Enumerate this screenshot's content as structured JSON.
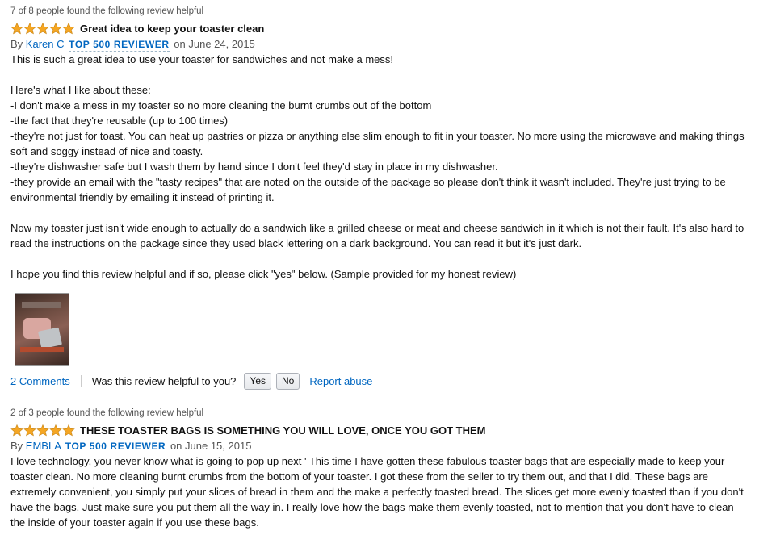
{
  "reviews": [
    {
      "helpful_count": "7 of 8 people found the following review helpful",
      "rating": 5,
      "title": "Great idea to keep your toaster clean",
      "by_prefix": "By",
      "author": "Karen C",
      "badge": "TOP 500 REVIEWER",
      "date": "on June 24, 2015",
      "paragraphs": [
        [
          "This is such a great idea to use your toaster for sandwiches and not make a mess!"
        ],
        [
          "Here's what I like about these:",
          "-I don't make a mess in my toaster so no more cleaning the burnt crumbs out of the bottom",
          "-the fact that they're reusable (up to 100 times)",
          "-they're not just for toast. You can heat up pastries or pizza or anything else slim enough to fit in your toaster. No more using the microwave and making things",
          "soft and soggy instead of nice and toasty.",
          "-they're dishwasher safe but I wash them by hand since I don't feel they'd stay in place in my dishwasher.",
          "-they provide an email with the \"tasty recipes\" that are noted on the outside of the package so please don't think it wasn't included. They're just trying to be",
          "environmental friendly by emailing it instead of printing it."
        ],
        [
          "Now my toaster just isn't wide enough to actually do a sandwich like a grilled cheese or meat and cheese sandwich in it which is not their fault. It's also hard to",
          "read the instructions on the package since they used black lettering on a dark background. You can read it but it's just dark."
        ],
        [
          "I hope you find this review helpful and if so, please click \"yes\" below. (Sample provided for my honest review)"
        ]
      ],
      "comments": "2 Comments",
      "helpful_question": "Was this review helpful to you?",
      "yes": "Yes",
      "no": "No",
      "report": "Report abuse"
    },
    {
      "helpful_count": "2 of 3 people found the following review helpful",
      "rating": 5,
      "title": "THESE TOASTER BAGS IS SOMETHING YOU WILL LOVE, ONCE YOU GOT THEM",
      "by_prefix": "By",
      "author": "EMBLA",
      "badge": "TOP 500 REVIEWER",
      "date": "on June 15, 2015",
      "paragraphs": [
        [
          "I love technology, you never know what is going to pop up next ' This time I have gotten these fabulous toaster bags that are especially made to keep your",
          "toaster clean. No more cleaning burnt crumbs from the bottom of your toaster. I got these from the seller to try them out, and that I did. These bags are",
          "extremely convenient, you simply put your slices of bread in them and the make a perfectly toasted bread. The slices get more evenly toasted than if you don't",
          "have the bags. Just make sure you put them all the way in. I really love how the bags make them evenly toasted, not to mention that you don't have to clean",
          "the inside of your toaster again if you use these bags."
        ]
      ]
    }
  ],
  "colors": {
    "link": "#0066c0",
    "star": "#f5a623",
    "badge": "#1d6b9a"
  },
  "icons": {
    "star": "star-icon"
  }
}
